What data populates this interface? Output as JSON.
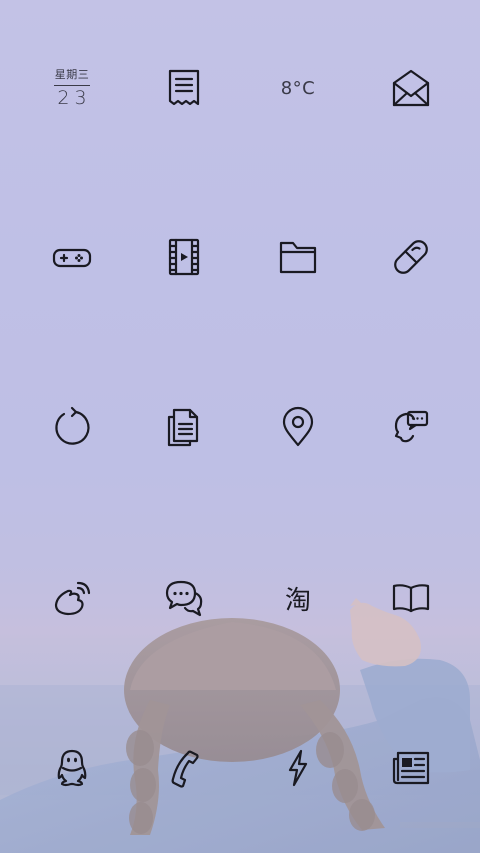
{
  "homescreen": {
    "calendar_widget": {
      "weekday": "星期三",
      "date": "23"
    },
    "weather_widget": {
      "temperature": "8°C"
    },
    "dock": {
      "taobao_glyph": "淘"
    },
    "apps": [
      {
        "icon": "calendar-widget"
      },
      {
        "icon": "receipt-icon"
      },
      {
        "icon": "weather-widget"
      },
      {
        "icon": "mail-icon"
      },
      {
        "icon": "gamepad-icon"
      },
      {
        "icon": "film-icon"
      },
      {
        "icon": "folder-icon"
      },
      {
        "icon": "pill-icon"
      },
      {
        "icon": "refresh-icon"
      },
      {
        "icon": "documents-icon"
      },
      {
        "icon": "location-pin-icon"
      },
      {
        "icon": "chat-head-icon"
      },
      {
        "icon": "weibo-icon"
      },
      {
        "icon": "chat-bubbles-icon"
      },
      {
        "icon": "taobao-icon"
      },
      {
        "icon": "book-icon"
      },
      {
        "icon": "qq-penguin-icon"
      },
      {
        "icon": "phone-icon"
      },
      {
        "icon": "lightning-icon"
      },
      {
        "icon": "news-icon"
      }
    ],
    "colors": {
      "icon_stroke": "#1a1a22",
      "sky_top": "#c2c1e6",
      "sky_horizon": "#c6bddb",
      "jacket_blue": "#8d9fc4",
      "hair_brown": "#9b8c88"
    }
  }
}
